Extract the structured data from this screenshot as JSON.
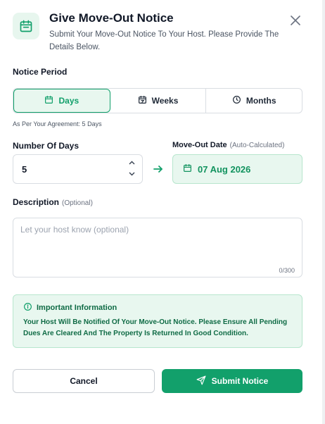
{
  "header": {
    "title": "Give Move-Out Notice",
    "subtitle": "Submit Your Move-Out Notice To Your Host. Please Provide The Details Below.",
    "icon": "calendar-icon"
  },
  "notice_period": {
    "label": "Notice Period",
    "options": [
      {
        "label": "Days",
        "icon": "calendar-icon",
        "active": true
      },
      {
        "label": "Weeks",
        "icon": "calendar-week-icon",
        "active": false
      },
      {
        "label": "Months",
        "icon": "clock-icon",
        "active": false
      }
    ],
    "hint": "As Per Your Agreement: 5 Days"
  },
  "number_of_days": {
    "label": "Number Of Days",
    "value": "5"
  },
  "move_out_date": {
    "label": "Move-Out Date",
    "note": "(Auto-Calculated)",
    "value": "07 Aug 2026"
  },
  "description": {
    "label": "Description",
    "note": "(Optional)",
    "placeholder": "Let your host know (optional)",
    "counter": "0/300"
  },
  "info": {
    "title": "Important Information",
    "text": "Your Host Will Be Notified Of Your Move-Out Notice. Please Ensure All Pending Dues Are Cleared And The Property Is Returned In Good Condition."
  },
  "actions": {
    "cancel": "Cancel",
    "submit": "Submit Notice"
  },
  "colors": {
    "accent": "#12a06b",
    "accent_bg": "#e8f7ef"
  }
}
